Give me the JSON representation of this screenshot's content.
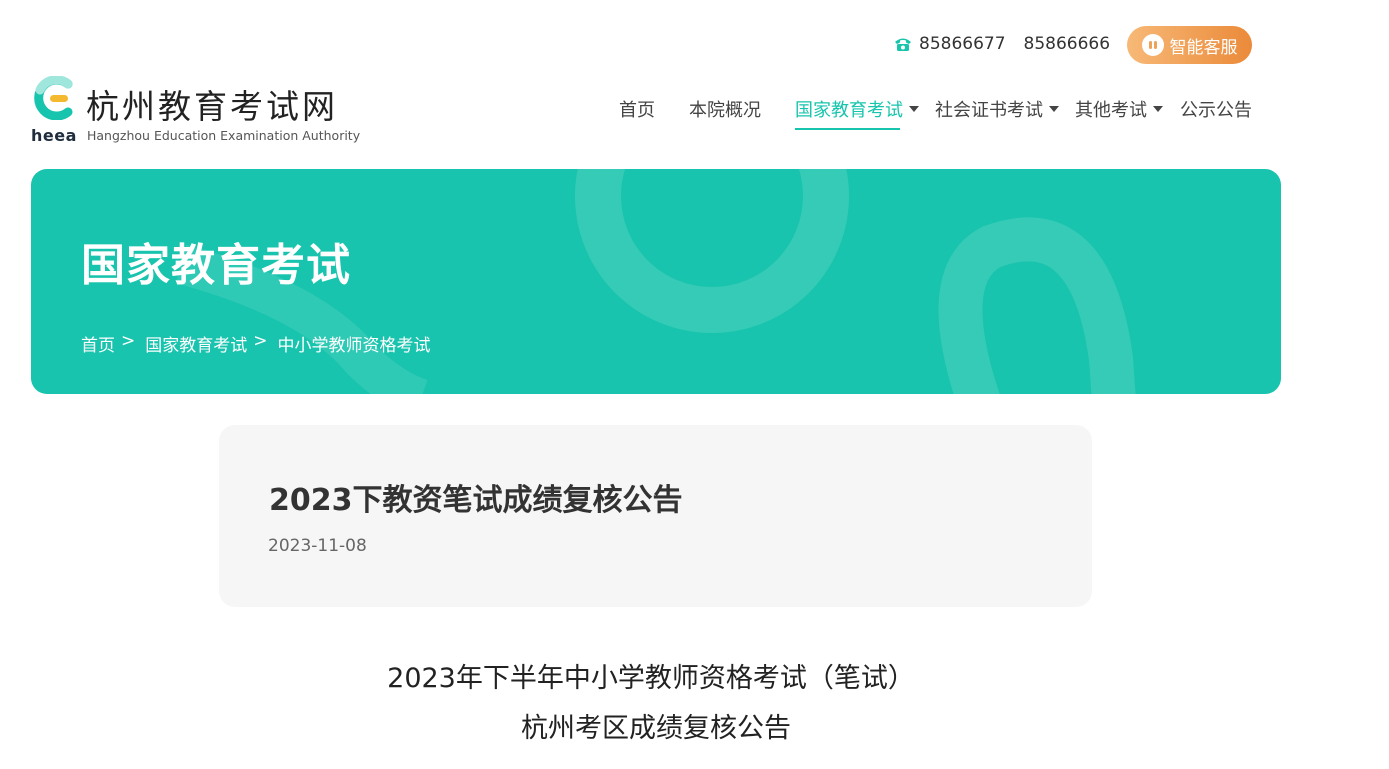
{
  "contact": {
    "phone_1": "85866677",
    "phone_2": "85866666",
    "ai_service_label": "智能客服",
    "icon": "phone-icon"
  },
  "logo": {
    "abbr": "heea",
    "name_cn": "杭州教育考试网",
    "name_en": "Hangzhou Education Examination Authority"
  },
  "nav": {
    "items": [
      {
        "label": "首页"
      },
      {
        "label": "本院概况"
      },
      {
        "label": "国家教育考试"
      },
      {
        "label": "社会证书考试"
      },
      {
        "label": "其他考试"
      },
      {
        "label": "公示公告"
      }
    ],
    "active_index": 2
  },
  "banner": {
    "title": "国家教育考试",
    "breadcrumb": [
      "首页",
      "国家教育考试",
      "中小学教师资格考试"
    ],
    "separator": ">"
  },
  "article": {
    "title": "2023下教资笔试成绩复核公告",
    "date": "2023-11-08",
    "heading_line1": "2023年下半年中小学教师资格考试（笔试）",
    "heading_line2": "杭州考区成绩复核公告"
  },
  "colors": {
    "accent": "#18c4ad",
    "ai_button_start": "#f7b977",
    "ai_button_end": "#eb8a3a",
    "card_bg": "#f6f6f6"
  }
}
